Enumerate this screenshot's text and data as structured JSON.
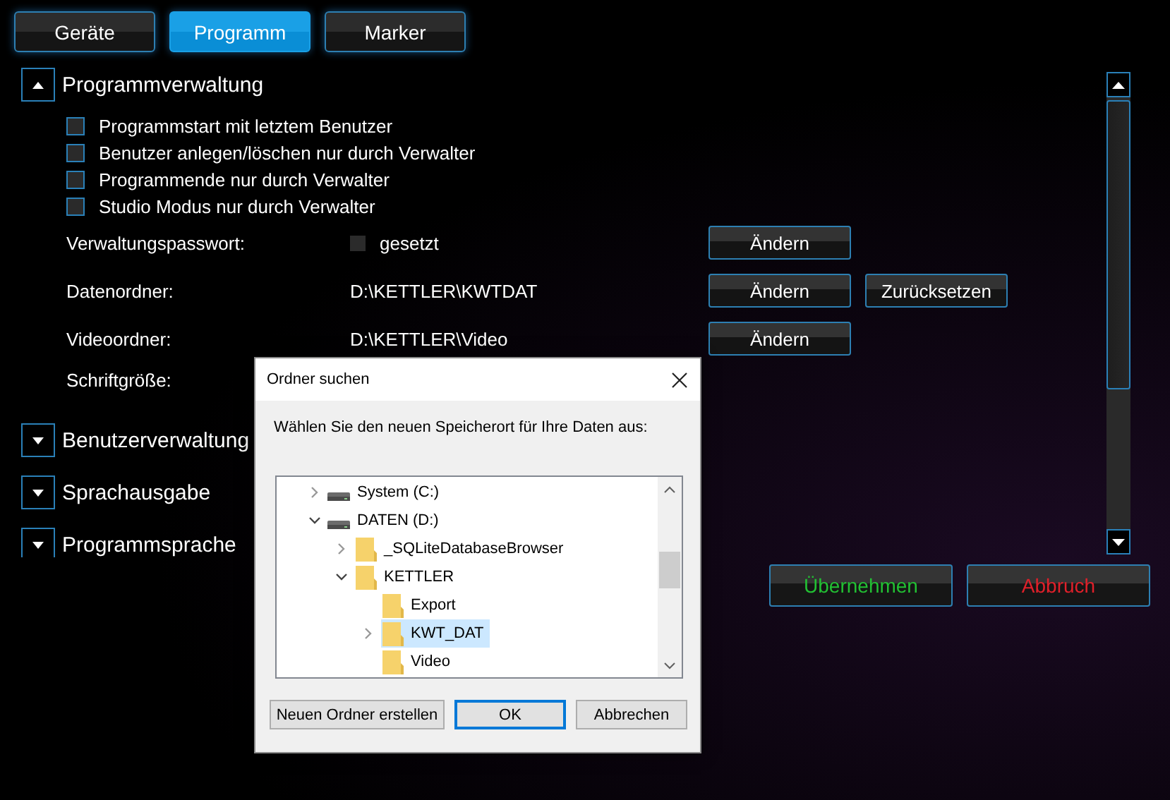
{
  "tabs": [
    {
      "label": "Geräte",
      "selected": false
    },
    {
      "label": "Programm",
      "selected": true
    },
    {
      "label": "Marker",
      "selected": false
    }
  ],
  "sections": [
    {
      "title": "Programmverwaltung",
      "expanded": true,
      "options": [
        {
          "label": "Programmstart mit letztem Benutzer",
          "checked": false
        },
        {
          "label": "Benutzer anlegen/löschen nur durch Verwalter",
          "checked": false
        },
        {
          "label": "Programmende nur durch Verwalter",
          "checked": false
        },
        {
          "label": "Studio Modus nur durch Verwalter",
          "checked": false
        }
      ],
      "rows": [
        {
          "label": "Verwaltungspasswort:",
          "kind": "flag",
          "value": "gesetzt",
          "checked": false,
          "buttons": [
            "Ändern"
          ]
        },
        {
          "label": "Datenordner:",
          "kind": "path",
          "value": "D:\\KETTLER\\KWTDAT",
          "buttons": [
            "Ändern",
            "Zurücksetzen"
          ]
        },
        {
          "label": "Videoordner:",
          "kind": "path",
          "value": "D:\\KETTLER\\Video",
          "buttons": [
            "Ändern"
          ]
        },
        {
          "label": "Schriftgröße:",
          "kind": "path"
        }
      ]
    },
    {
      "title": "Benutzerverwaltung",
      "expanded": false
    },
    {
      "title": "Sprachausgabe",
      "expanded": false
    },
    {
      "title": "Programmsprache",
      "expanded": false
    }
  ],
  "actions": [
    {
      "label": "Übernehmen",
      "kind": "confirm"
    },
    {
      "label": "Abbruch",
      "kind": "cancel"
    }
  ],
  "dialog": {
    "title": "Ordner suchen",
    "prompt": "Wählen Sie den neuen Speicherort für Ihre Daten aus:",
    "tree": [
      {
        "label": "System (C:)",
        "kind": "drive",
        "expanded": false,
        "selected": false
      },
      {
        "label": "DATEN (D:)",
        "kind": "drive",
        "expanded": true,
        "selected": false,
        "children": [
          {
            "label": "_SQLiteDatabaseBrowser",
            "kind": "folder",
            "expanded": false,
            "selected": false
          },
          {
            "label": "KETTLER",
            "kind": "folder",
            "expanded": true,
            "selected": false,
            "children": [
              {
                "label": "Export",
                "kind": "folder",
                "selected": false
              },
              {
                "label": "KWT_DAT",
                "kind": "folder",
                "expanded": false,
                "selected": true
              },
              {
                "label": "Video",
                "kind": "folder",
                "selected": false
              }
            ]
          }
        ]
      }
    ],
    "buttons": [
      {
        "label": "Neuen Ordner erstellen",
        "default": false
      },
      {
        "label": "OK",
        "default": true
      },
      {
        "label": "Abbrechen",
        "default": false
      }
    ]
  }
}
